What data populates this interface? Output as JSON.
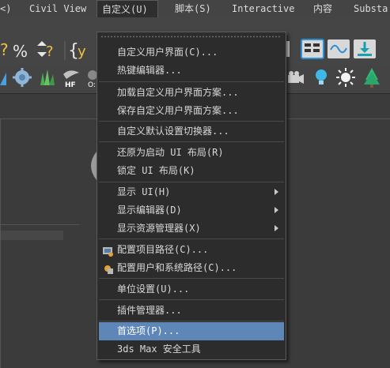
{
  "menubar": {
    "items": [
      {
        "label": "<)"
      },
      {
        "label": "Civil View"
      },
      {
        "label": "自定义(U)"
      },
      {
        "label": "脚本(S)"
      },
      {
        "label": "Interactive"
      },
      {
        "label": "内容"
      },
      {
        "label": "Substa"
      }
    ]
  },
  "customize_menu": {
    "items": [
      {
        "label": "自定义用户界面(C)..."
      },
      {
        "label": "热键编辑器..."
      },
      {
        "label": "加载自定义用户界面方案..."
      },
      {
        "label": "保存自定义用户界面方案..."
      },
      {
        "label": "自定义默认设置切换器..."
      },
      {
        "label": "还原为启动 UI 布局(R)"
      },
      {
        "label": "锁定 UI 布局(K)"
      },
      {
        "label": "显示 UI(H)"
      },
      {
        "label": "显示编辑器(D)"
      },
      {
        "label": "显示资源管理器(X)"
      },
      {
        "label": "配置项目路径(C)..."
      },
      {
        "label": "配置用户和系统路径(C)..."
      },
      {
        "label": "单位设置(U)..."
      },
      {
        "label": "插件管理器..."
      },
      {
        "label": "首选项(P)..."
      },
      {
        "label": "3ds Max 安全工具"
      }
    ],
    "highlighted": "首选项(P)..."
  },
  "toolbar": {
    "labels": [
      "HF",
      "O:"
    ]
  },
  "colors": {
    "menu_bg": "#2c2c2c",
    "highlight": "#5e87b8",
    "accent_blue": "#2f8fd6"
  }
}
